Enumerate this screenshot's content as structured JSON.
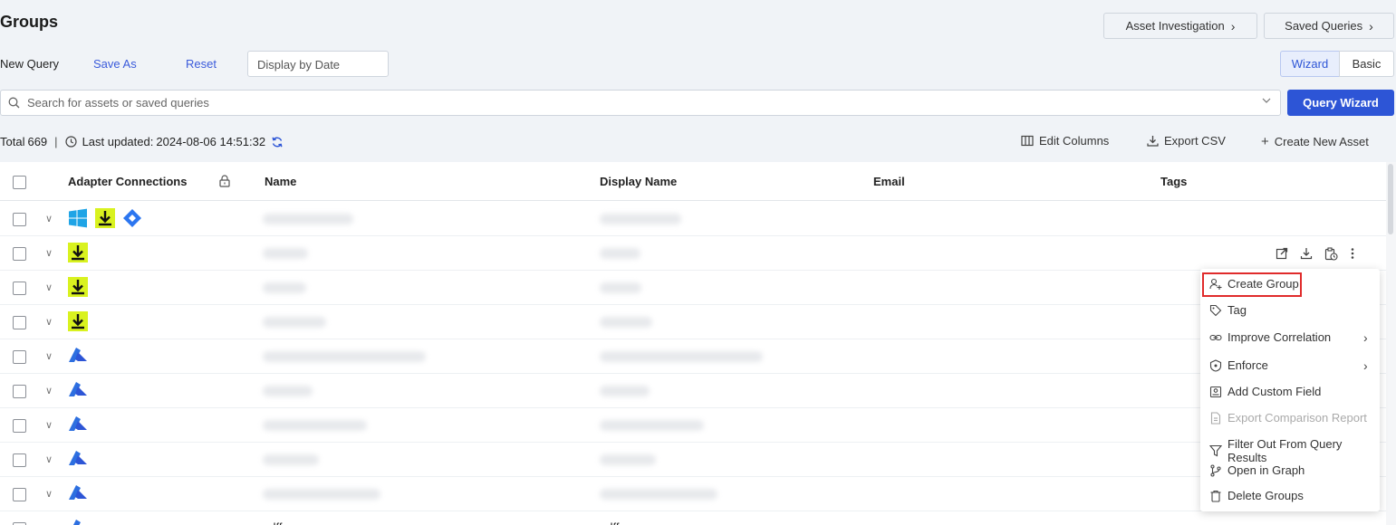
{
  "header": {
    "title": "Groups",
    "asset_investigation": "Asset Investigation",
    "saved_queries": "Saved Queries"
  },
  "query_bar": {
    "new_query": "New Query",
    "save_as": "Save As",
    "reset": "Reset",
    "display_by_date": "Display by Date",
    "wizard": "Wizard",
    "basic": "Basic"
  },
  "search": {
    "placeholder": "Search for assets or saved queries",
    "query_wizard": "Query Wizard"
  },
  "status": {
    "total_label": "Total",
    "total_value": "669",
    "last_updated_label": "Last updated:",
    "last_updated_value": "2024-08-06 14:51:32"
  },
  "toolbar": {
    "edit_columns": "Edit Columns",
    "export_csv": "Export CSV",
    "create_new_asset": "Create New Asset"
  },
  "table": {
    "columns": [
      "Adapter Connections",
      "Name",
      "Display Name",
      "Email",
      "Tags"
    ],
    "rows": [
      {
        "adapters": [
          "windows",
          "download",
          "jira"
        ]
      },
      {
        "adapters": [
          "download"
        ]
      },
      {
        "adapters": [
          "download"
        ]
      },
      {
        "adapters": [
          "download"
        ]
      },
      {
        "adapters": [
          "azure"
        ]
      },
      {
        "adapters": [
          "azure"
        ]
      },
      {
        "adapters": [
          "azure"
        ]
      },
      {
        "adapters": [
          "azure"
        ]
      },
      {
        "adapters": [
          "azure"
        ]
      },
      {
        "adapters": [
          "azure"
        ],
        "name": "adff_group",
        "display_name": "adff_group"
      }
    ]
  },
  "context_menu": {
    "items": [
      {
        "label": "Create Group",
        "icon": "create-group-icon",
        "highlighted": true
      },
      {
        "label": "Tag",
        "icon": "tag-icon"
      },
      {
        "label": "Improve Correlation",
        "icon": "link-icon",
        "submenu": true
      },
      {
        "label": "Enforce",
        "icon": "enforce-icon",
        "submenu": true
      },
      {
        "label": "Add Custom Field",
        "icon": "custom-field-icon"
      },
      {
        "label": "Export Comparison Report",
        "icon": "report-icon",
        "disabled": true
      },
      {
        "label": "Filter Out From Query Results",
        "icon": "filter-icon"
      },
      {
        "label": "Open in Graph",
        "icon": "graph-icon"
      },
      {
        "label": "Delete Groups",
        "icon": "trash-icon"
      }
    ]
  },
  "colors": {
    "accent": "#2d55d6",
    "link": "#3b5bdb",
    "highlight_border": "#e02b2b",
    "download_badge": "#d9f21f"
  }
}
